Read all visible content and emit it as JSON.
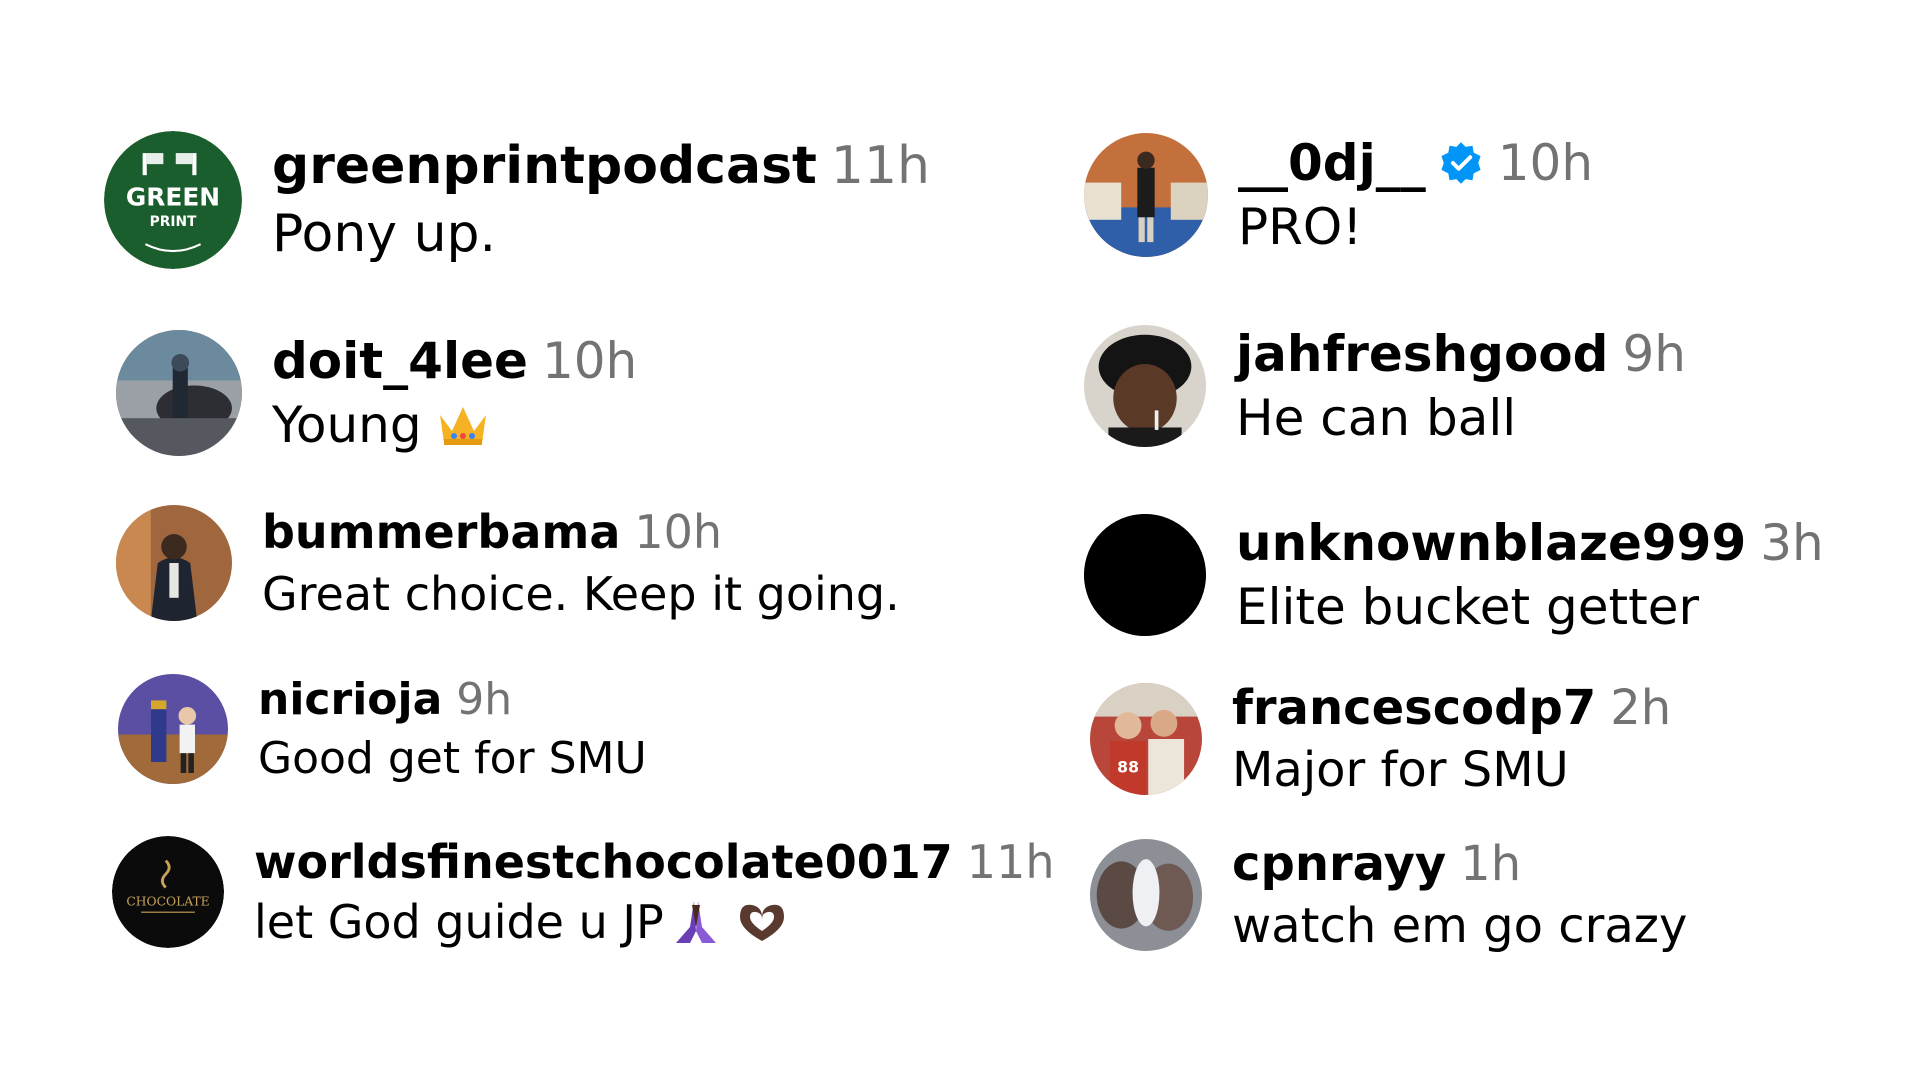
{
  "comments": [
    {
      "username": "greenprintpodcast",
      "time": "11h",
      "text": "Pony up.",
      "avatar": {
        "type": "logo",
        "color": "#1b5e2e",
        "logo_line1": "GREEN",
        "logo_line2": "PRINT"
      }
    },
    {
      "username": "doit_4lee",
      "time": "10h",
      "text": "Young",
      "emoji": "crown-emoji",
      "avatar": {
        "type": "photo",
        "color": "#6f7278"
      }
    },
    {
      "username": "bummerbama",
      "time": "10h",
      "text": "Great choice. Keep it going.",
      "avatar": {
        "type": "photo",
        "color": "#8a5a3c"
      }
    },
    {
      "username": "nicrioja",
      "time": "9h",
      "text": "Good get for SMU",
      "avatar": {
        "type": "photo",
        "color": "#4c4a8f"
      }
    },
    {
      "username": "worldsfinestchocolate0017",
      "time": "11h",
      "text": "let God guide u JP",
      "emojis": [
        "praying-hands-emoji",
        "heart-hands-emoji"
      ],
      "avatar": {
        "type": "logo",
        "color": "#0b0b0b",
        "logo_line1": "CHOCOLATE"
      }
    },
    {
      "username": "__0dj__",
      "time": "10h",
      "verified": true,
      "text": "PRO!",
      "avatar": {
        "type": "photo",
        "color": "#b8643b"
      }
    },
    {
      "username": "jahfreshgood",
      "time": "9h",
      "text": "He can ball",
      "avatar": {
        "type": "photo",
        "color": "#3b2a21"
      }
    },
    {
      "username": "unknownblaze999",
      "time": "3h",
      "text": "Elite bucket getter",
      "avatar": {
        "type": "solid",
        "color": "#000000"
      }
    },
    {
      "username": "francescodp7",
      "time": "2h",
      "text": "Major for SMU",
      "avatar": {
        "type": "photo",
        "color": "#c0392b"
      }
    },
    {
      "username": "cpnrayy",
      "time": "1h",
      "text": "watch em go crazy",
      "avatar": {
        "type": "photo",
        "color": "#7c7f86"
      }
    }
  ],
  "colors": {
    "username": "#000000",
    "timestamp": "#737373",
    "verified_badge": "#0095f6"
  }
}
